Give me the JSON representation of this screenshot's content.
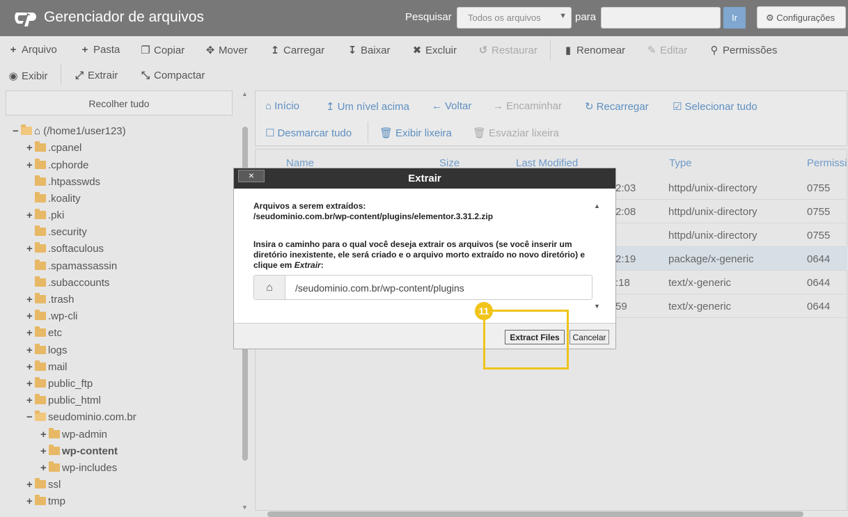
{
  "header": {
    "title": "Gerenciador de arquivos",
    "search_label": "Pesquisar",
    "search_scope": "Todos os arquivos",
    "for_label": "para",
    "search_value": "",
    "go_label": "Ir",
    "settings_label": "Configurações"
  },
  "toolbar": {
    "row1": [
      {
        "label": "Arquivo",
        "icon": "plus-icon"
      },
      {
        "label": "Pasta",
        "icon": "plus-icon"
      },
      {
        "label": "Copiar",
        "icon": "copy-icon"
      },
      {
        "label": "Mover",
        "icon": "move-icon"
      },
      {
        "label": "Carregar",
        "icon": "upload-icon"
      },
      {
        "label": "Baixar",
        "icon": "download-icon"
      },
      {
        "label": "Excluir",
        "icon": "close-icon"
      },
      {
        "label": "Restaurar",
        "icon": "undo-icon"
      },
      {
        "label": "Renomear",
        "icon": "file-icon"
      },
      {
        "label": "Editar",
        "icon": "pencil-icon"
      },
      {
        "label": "Permissões",
        "icon": "key-icon"
      }
    ],
    "row2": [
      {
        "label": "Exibir",
        "icon": "eye-icon"
      },
      {
        "label": "Extrair",
        "icon": "expand-icon"
      },
      {
        "label": "Compactar",
        "icon": "compress-icon"
      }
    ]
  },
  "sidebar": {
    "collapse_label": "Recolher tudo",
    "root": "(/home1/user123)",
    "items": [
      ".cpanel",
      ".cphorde",
      ".htpasswds",
      ".koality",
      ".pki",
      ".security",
      ".softaculous",
      ".spamassassin",
      ".subaccounts",
      ".trash",
      ".wp-cli",
      "etc",
      "logs",
      "mail",
      "public_ftp",
      "public_html",
      "seudominio.com.br",
      "wp-admin",
      "wp-content",
      "wp-includes",
      "ssl",
      "tmp"
    ]
  },
  "nav": {
    "home": "Início",
    "up": "Um nível acima",
    "back": "Voltar",
    "forward": "Encaminhar",
    "reload": "Recarregar",
    "select_all": "Selecionar tudo",
    "unselect_all": "Desmarcar tudo",
    "show_trash": "Exibir lixeira",
    "empty_trash": "Esvaziar lixeira"
  },
  "table": {
    "headers": {
      "name": "Name",
      "size": "Size",
      "modified": "Last Modified",
      "type": "Type",
      "perms": "Permissi"
    },
    "rows": [
      {
        "modified": "2:03",
        "type": "httpd/unix-directory",
        "perms": "0755"
      },
      {
        "modified": "2:08",
        "type": "httpd/unix-directory",
        "perms": "0755"
      },
      {
        "modified": "",
        "type": "httpd/unix-directory",
        "perms": "0755"
      },
      {
        "modified": "2:19",
        "type": "package/x-generic",
        "perms": "0644"
      },
      {
        "modified": ":18",
        "type": "text/x-generic",
        "perms": "0644"
      },
      {
        "modified": "59",
        "type": "text/x-generic",
        "perms": "0644"
      }
    ]
  },
  "dialog": {
    "close_label": "×",
    "title": "Extrair",
    "files_label": "Arquivos a serem extraídos:",
    "file_path": "/seudominio.com.br/wp-content/plugins/elementor.3.31.2.zip",
    "instructions_a": "Insira o caminho para o qual você deseja extrair os arquivos (se você inserir um diretório inexistente, ele será criado e o arquivo morto extraído no novo diretório) e clique em ",
    "instructions_em": "Extrair",
    "instructions_b": ":",
    "target_path": "/seudominio.com.br/wp-content/plugins",
    "extract_label": "Extract Files",
    "cancel_label": "Cancelar"
  },
  "annotation": {
    "step": "11",
    "color": "#f0c419"
  }
}
